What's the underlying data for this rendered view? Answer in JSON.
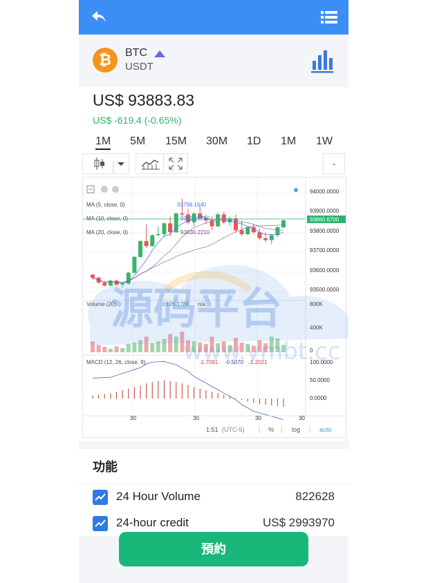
{
  "header": {
    "back_icon": "back-arrow-icon",
    "menu_icon": "list-menu-icon"
  },
  "pair": {
    "base": "BTC",
    "quote": "USDT",
    "coin_glyph": "₿",
    "coin_color": "#f7931a",
    "trend_icon": "triangle-up-icon",
    "chart_icon": "bar-chart-icon"
  },
  "ticker": {
    "price": "US$ 93883.83",
    "change": "US$ -619.4 (-0.65%)",
    "change_color": "#2db36b"
  },
  "intervals": [
    "1M",
    "5M",
    "15M",
    "30M",
    "1D",
    "1M",
    "1W"
  ],
  "active_interval": 0,
  "chart": {
    "legend": {
      "ma5": "MA (5, close, 0)",
      "ma5_val": "93798.1640",
      "ma10": "MA (10, close, 0)",
      "ma10_val": "93801.7750",
      "ma20": "MA (20, close, 0)",
      "ma20_val": "93830.2210",
      "volume": "Volume (20)",
      "volume_val": "126.178K",
      "volume_na": "n/a",
      "macd": "MACD (12, 26, close, 9)",
      "macd_v1": "-1.7091",
      "macd_v2": "-0.5070",
      "macd_v3": "1.2021"
    },
    "price_axis": [
      "94000.0000",
      "93900.0000",
      "93800.0000",
      "93700.0000",
      "93600.0000",
      "93500.0000"
    ],
    "last_price_tag": "93860.6700",
    "volume_axis": [
      "800K",
      "400K",
      "0"
    ],
    "macd_axis": [
      "100.0000",
      "50.0000",
      "0.0000"
    ],
    "time_ticks": [
      "30",
      "30",
      "30",
      "30"
    ],
    "footer": {
      "time": "1:51",
      "tz": "(UTC-5)",
      "percent": "%",
      "log": "log",
      "auto": "auto"
    }
  },
  "chart_data": {
    "type": "candlestick",
    "series": [
      {
        "name": "price",
        "ohlc": [
          [
            93585,
            93590,
            93560,
            93570
          ],
          [
            93570,
            93575,
            93540,
            93545
          ],
          [
            93545,
            93550,
            93525,
            93530
          ],
          [
            93530,
            93560,
            93525,
            93555
          ],
          [
            93555,
            93560,
            93530,
            93535
          ],
          [
            93535,
            93545,
            93520,
            93540
          ],
          [
            93540,
            93600,
            93535,
            93595
          ],
          [
            93595,
            93680,
            93590,
            93675
          ],
          [
            93675,
            93760,
            93670,
            93755
          ],
          [
            93755,
            93840,
            93720,
            93730
          ],
          [
            93730,
            93790,
            93725,
            93785
          ],
          [
            93785,
            93830,
            93780,
            93790
          ],
          [
            93790,
            93850,
            93775,
            93845
          ],
          [
            93845,
            93880,
            93780,
            93800
          ],
          [
            93800,
            93900,
            93795,
            93895
          ],
          [
            93895,
            93970,
            93880,
            93890
          ],
          [
            93890,
            93920,
            93840,
            93850
          ],
          [
            93850,
            93900,
            93830,
            93895
          ],
          [
            93895,
            93930,
            93860,
            93870
          ],
          [
            93870,
            93890,
            93840,
            93860
          ],
          [
            93860,
            93880,
            93810,
            93830
          ],
          [
            93830,
            93900,
            93825,
            93890
          ],
          [
            93890,
            93905,
            93840,
            93850
          ],
          [
            93850,
            93880,
            93835,
            93870
          ],
          [
            93870,
            93890,
            93800,
            93810
          ],
          [
            93810,
            93860,
            93780,
            93790
          ],
          [
            93790,
            93830,
            93785,
            93825
          ],
          [
            93825,
            93840,
            93790,
            93800
          ],
          [
            93800,
            93820,
            93760,
            93770
          ],
          [
            93770,
            93800,
            93750,
            93760
          ],
          [
            93760,
            93790,
            93740,
            93785
          ],
          [
            93785,
            93830,
            93775,
            93825
          ],
          [
            93825,
            93865,
            93820,
            93860
          ]
        ]
      }
    ],
    "volume": [
      180,
      120,
      90,
      60,
      100,
      70,
      140,
      160,
      200,
      260,
      150,
      180,
      220,
      300,
      260,
      340,
      200,
      180,
      160,
      140,
      260,
      150,
      180,
      120,
      240,
      160,
      140,
      110,
      200,
      150,
      260,
      230,
      120
    ],
    "macd_hist": [
      8,
      10,
      12,
      14,
      18,
      22,
      26,
      30,
      34,
      40,
      44,
      46,
      48,
      46,
      44,
      40,
      36,
      30,
      26,
      22,
      18,
      14,
      10,
      6,
      2,
      -4,
      -8,
      -12,
      -14,
      -16,
      -18,
      -20,
      -22
    ]
  },
  "features": {
    "title": "功能",
    "rows": [
      {
        "label": "24 Hour Volume",
        "value": "822628"
      },
      {
        "label": "24-hour credit",
        "value": "US$ 2993970"
      }
    ]
  },
  "reserve_button": "預約",
  "watermark": {
    "text": "源码平台",
    "url": "www.ymbt.cc"
  }
}
